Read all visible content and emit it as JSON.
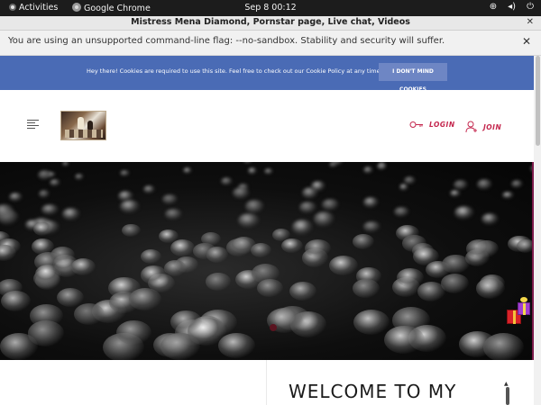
{
  "system_bar": {
    "activities": "Activities",
    "app_name": "Google Chrome",
    "clock": "Sep 8  00:12",
    "tray_icons": [
      "network-icon",
      "volume-icon",
      "power-icon"
    ]
  },
  "browser": {
    "window_title": "Mistress Mena Diamond, Pornstar page, Live chat, Videos",
    "close_glyph": "✕",
    "infobar_message": "You are using an unsupported command-line flag: --no-sandbox. Stability and security will suffer.",
    "infobar_close": "✕"
  },
  "cookie_banner": {
    "text": "Hey there! Cookies are required to use this site. Feel free to check out our Cookie Policy at any time.",
    "button": "I DON'T MIND COOKIES",
    "background": "#4a6bb5"
  },
  "header": {
    "login_label": "LOGIN",
    "join_label": "JOIN",
    "accent": "#c4264d"
  },
  "hero": {
    "slide_indicator_active": 1
  },
  "main": {
    "welcome_heading": "WELCOME TO MY"
  }
}
